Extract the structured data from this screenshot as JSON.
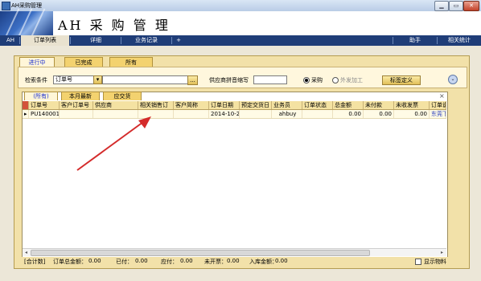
{
  "window": {
    "title": "AH采购管理",
    "controls": [
      "▁",
      "▭",
      "✕"
    ]
  },
  "banner": {
    "title": "AH 采 购 管 理"
  },
  "tabs": {
    "items": [
      "AH",
      "订单列表",
      "详细",
      "业务记录",
      "+"
    ],
    "right_items": [
      "助手",
      "相关统计"
    ],
    "active": "订单列表"
  },
  "status_tabs": [
    "进行中",
    "已完成",
    "所有"
  ],
  "filter": {
    "condition_label": "检索条件",
    "condition_value": "订单号",
    "search_value": "",
    "browse_button": "...",
    "supplier_label": "供应商拼音缩写",
    "supplier_value": "",
    "radio_purchase": "采购",
    "radio_outsource": "外发加工",
    "selected_radio": "采购",
    "tag_button": "标签定义"
  },
  "grid_tabs": [
    "(所有)",
    "本月最新",
    "应交货"
  ],
  "grid": {
    "columns": [
      "订单号",
      "客户订单号",
      "供应商",
      "相关销售订",
      "客户简称",
      "订单日期",
      "预定交货日",
      "业务员",
      "订单状态",
      "总金额",
      "未付款",
      "未收发票",
      "订单说"
    ],
    "rows": [
      [
        "PU140001",
        "",
        "",
        "",
        "",
        "2014-10-2",
        "",
        "ahbuy",
        "",
        "0.00",
        "0.00",
        "0.00",
        "东莞下"
      ]
    ],
    "close_mark": "×"
  },
  "footer": {
    "count_label": "[合计数]",
    "total_label": "订单总金额：",
    "total_value": "0.00",
    "paid_label": "已付：",
    "paid_value": "0.00",
    "payable_label": "应付：",
    "payable_value": "0.00",
    "uninvoiced_label": "未开票：",
    "uninvoiced_value": "0.00",
    "stock_label": "入库金额：",
    "stock_value": "0.00",
    "show_material_label": "显示物料"
  },
  "colors": {
    "tabbar": "#1f3d78",
    "panel": "#f2e1a9",
    "arrow": "#d42b2b"
  }
}
